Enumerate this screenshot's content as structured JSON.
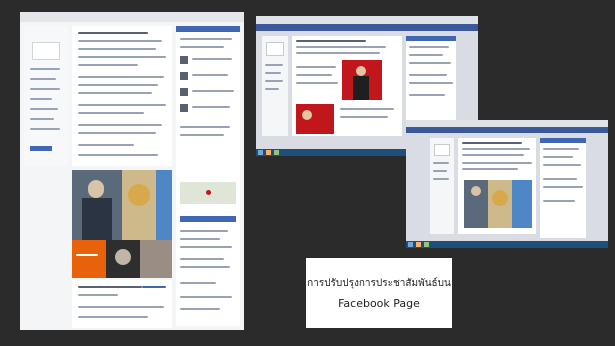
{
  "slide": {
    "caption_line1": "การปรับปรุงการประชาสัมพันธ์บน",
    "caption_line2": "Facebook Page"
  },
  "colors": {
    "background": "#2b2b2b",
    "facebook_blue": "#3b5998",
    "facebook_canvas": "#e9ebee",
    "windows_taskbar": "#1e4f7a",
    "accent_red": "#c0161c",
    "accent_orange": "#e8620c"
  },
  "screenshots": [
    {
      "label": "facebook-page-full-screenshot"
    },
    {
      "label": "facebook-page-desktop-screenshot-1"
    },
    {
      "label": "facebook-page-desktop-screenshot-2"
    }
  ]
}
